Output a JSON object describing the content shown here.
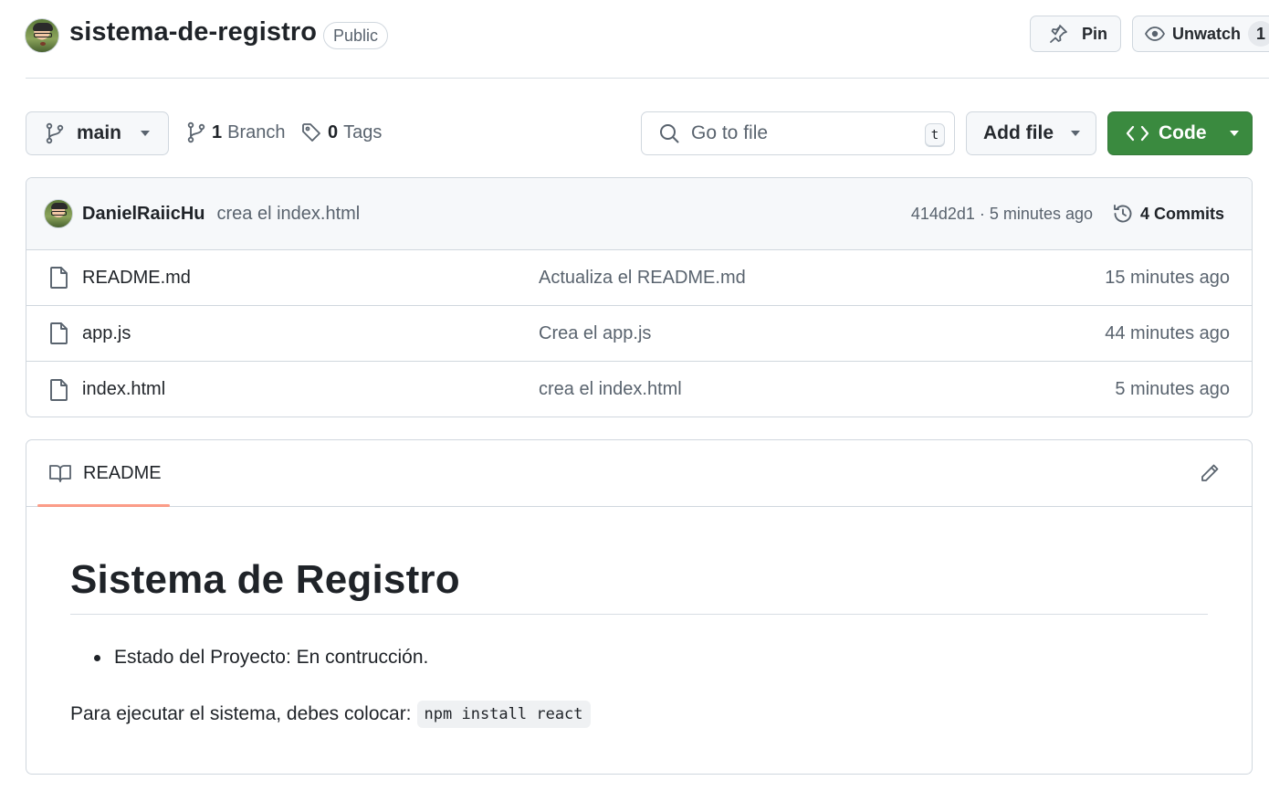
{
  "header": {
    "repo_name": "sistema-de-registro",
    "visibility_badge": "Public",
    "pin_label": "Pin",
    "unwatch_label": "Unwatch",
    "watch_count": "1"
  },
  "toolbar": {
    "branch_name": "main",
    "branch_count": "1",
    "branch_label": "Branch",
    "tag_count": "0",
    "tag_label": "Tags",
    "search_placeholder": "Go to file",
    "search_shortcut": "t",
    "add_file_label": "Add file",
    "code_label": "Code",
    "code_color": "#3a8a3f"
  },
  "latest_commit": {
    "author": "DanielRaiicHu",
    "message": "crea el index.html",
    "meta": "414d2d1 · 5 minutes ago",
    "commits_count_label": "4 Commits"
  },
  "files": [
    {
      "name": "README.md",
      "message": "Actualiza el README.md",
      "age": "15 minutes ago",
      "icon": "file-icon"
    },
    {
      "name": "app.js",
      "message": "Crea el app.js",
      "age": "44 minutes ago",
      "icon": "file-icon"
    },
    {
      "name": "index.html",
      "message": "crea el index.html",
      "age": "5 minutes ago",
      "icon": "file-icon"
    }
  ],
  "readme": {
    "tab_label": "README",
    "heading": "Sistema de Registro",
    "list_items": [
      "Estado del Proyecto: En contrucción."
    ],
    "paragraph_text": "Para ejecutar el sistema, debes colocar:",
    "paragraph_code": "npm install react",
    "accent_color": "#fd8c73"
  }
}
